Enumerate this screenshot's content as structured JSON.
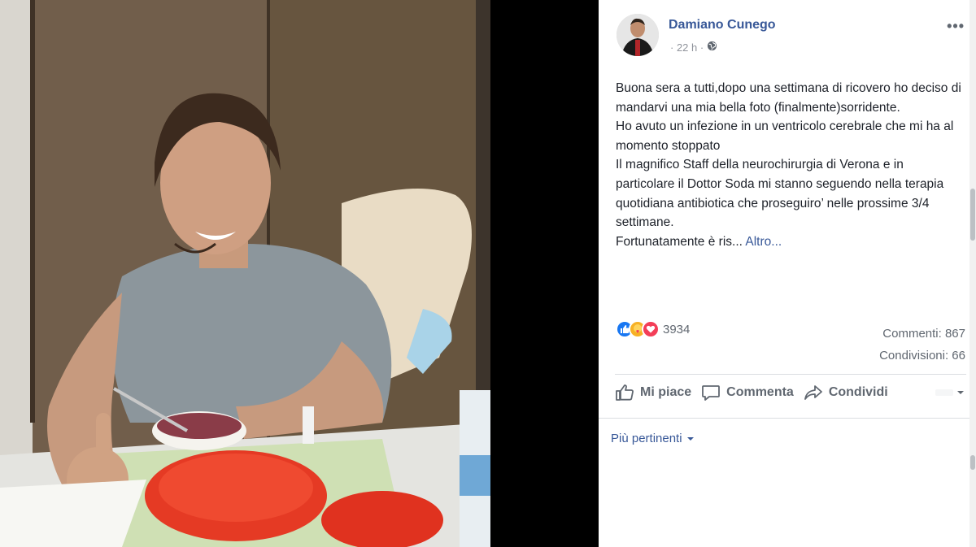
{
  "post": {
    "author": "Damiano Cunego",
    "time": "· 22 h ·",
    "privacy_icon": "globe-icon",
    "text_lines": [
      "Buona sera a tutti,dopo una settimana di ricovero ho deciso di mandarvi una mia bella foto (finalmente)sorridente.",
      "Ho avuto un infezione in un ventricolo cerebrale che mi ha al momento stoppato",
      "Il magnifico Staff della neurochirurgia di Verona e in particolare il Dottor Soda mi stanno seguendo nella terapia quotidiana antibiotica che proseguiro’ nelle prossime 3/4 settimane."
    ],
    "truncated_text": "Fortunatamente è ris...",
    "see_more": "Altro..."
  },
  "reactions": {
    "icons": [
      "like-icon",
      "care-icon",
      "love-icon"
    ],
    "count": "3934",
    "comments": "Commenti: 867",
    "shares": "Condivisioni: 66"
  },
  "actions": {
    "like": "Mi piace",
    "comment": "Commenta",
    "share": "Condividi"
  },
  "comments_sort": {
    "label": "Più pertinenti"
  },
  "colors": {
    "link": "#385898",
    "like_blue": "#1877f2",
    "love_red": "#f33e58",
    "care_yellow": "#f7b125"
  }
}
